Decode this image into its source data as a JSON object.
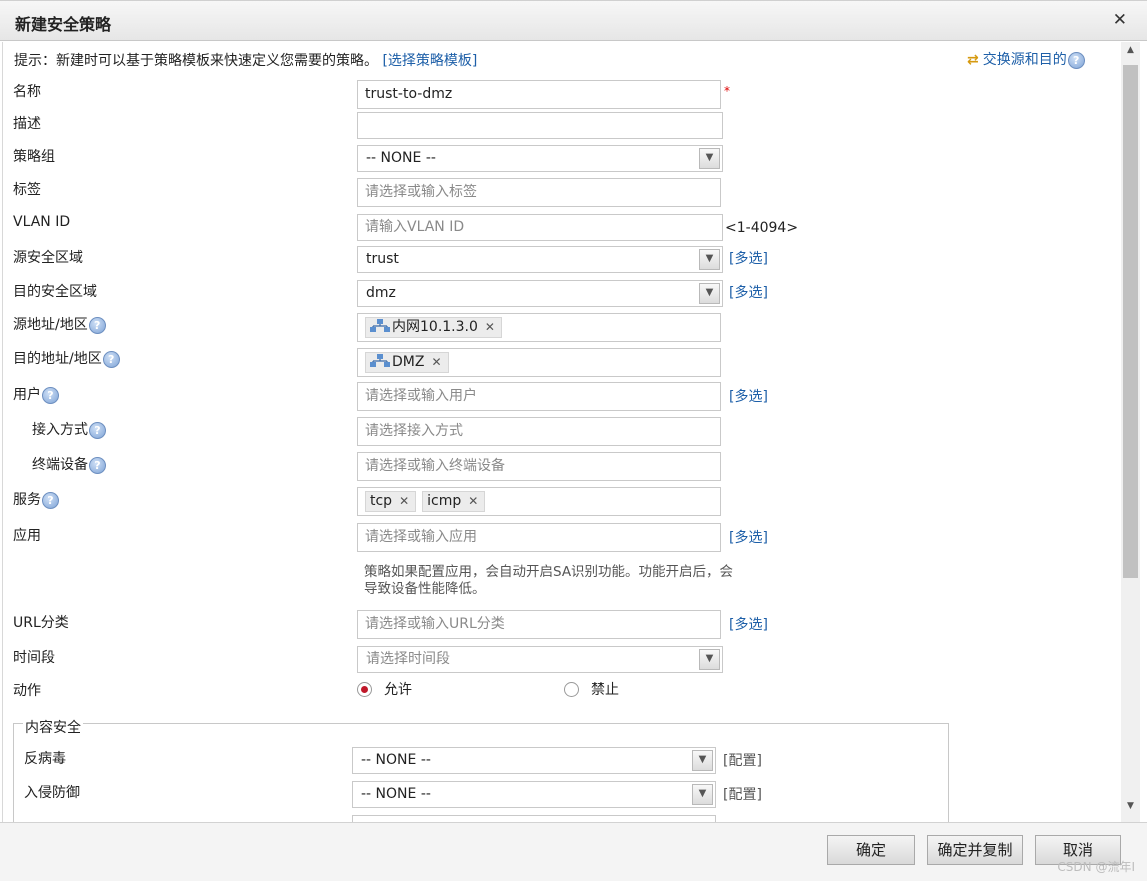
{
  "dialog": {
    "title": "新建安全策略",
    "close_glyph": "✕"
  },
  "hint": {
    "text": "提示：新建时可以基于策略模板来快速定义您需要的策略。",
    "link": "[选择策略模板]"
  },
  "swap": {
    "label": "交换源和目的"
  },
  "help_glyph": "?",
  "required_mark": "*",
  "form": {
    "name": {
      "label": "名称",
      "value": "trust-to-dmz"
    },
    "description": {
      "label": "描述",
      "value": ""
    },
    "policy_group": {
      "label": "策略组",
      "value": "-- NONE --"
    },
    "tag": {
      "label": "标签",
      "placeholder": "请选择或输入标签"
    },
    "vlan": {
      "label": "VLAN ID",
      "placeholder": "请输入VLAN ID",
      "range": "<1-4094>"
    },
    "src_zone": {
      "label": "源安全区域",
      "value": "trust",
      "multi": "[多选]"
    },
    "dst_zone": {
      "label": "目的安全区域",
      "value": "dmz",
      "multi": "[多选]"
    },
    "src_addr": {
      "label": "源地址/地区",
      "tags": [
        "内网10.1.3.0"
      ]
    },
    "dst_addr": {
      "label": "目的地址/地区",
      "tags": [
        "DMZ"
      ]
    },
    "user": {
      "label": "用户",
      "placeholder": "请选择或输入用户",
      "multi": "[多选]"
    },
    "access_mode": {
      "label": "接入方式",
      "placeholder": "请选择接入方式"
    },
    "terminal": {
      "label": "终端设备",
      "placeholder": "请选择或输入终端设备"
    },
    "service": {
      "label": "服务",
      "tags": [
        "tcp",
        "icmp"
      ]
    },
    "application": {
      "label": "应用",
      "placeholder": "请选择或输入应用",
      "multi": "[多选]",
      "note": "策略如果配置应用，会自动开启SA识别功能。功能开启后，会导致设备性能降低。"
    },
    "url_category": {
      "label": "URL分类",
      "placeholder": "请选择或输入URL分类",
      "multi": "[多选]"
    },
    "time_range": {
      "label": "时间段",
      "placeholder": "请选择时间段"
    },
    "action": {
      "label": "动作",
      "options": [
        "允许",
        "禁止"
      ],
      "selected": "允许"
    }
  },
  "content_security": {
    "legend": "内容安全",
    "antivirus": {
      "label": "反病毒",
      "value": "-- NONE --",
      "config": "[配置]"
    },
    "ips": {
      "label": "入侵防御",
      "value": "-- NONE --",
      "config": "[配置]"
    }
  },
  "buttons": {
    "ok": "确定",
    "ok_copy": "确定并复制",
    "cancel": "取消"
  },
  "watermark": "CSDN @流年I",
  "colors": {
    "link": "#1d5fa8",
    "required": "#dd0000",
    "radio_selected": "#c0182a"
  }
}
